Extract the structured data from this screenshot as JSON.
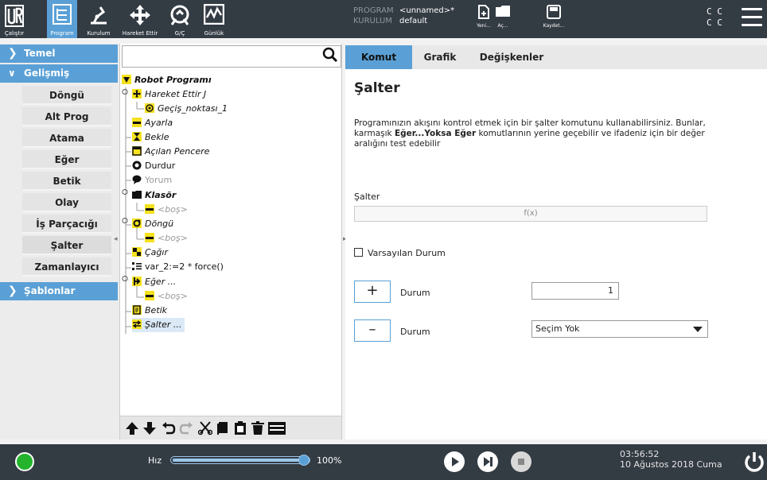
{
  "topbar": {
    "nav": [
      {
        "id": "run",
        "label": "Çalıştır",
        "icon": "ur-logo-icon"
      },
      {
        "id": "program",
        "label": "Program",
        "icon": "program-icon",
        "active": true
      },
      {
        "id": "installation",
        "label": "Kurulum",
        "icon": "installation-icon"
      },
      {
        "id": "move",
        "label": "Hareket Ettir",
        "icon": "move-icon"
      },
      {
        "id": "io",
        "label": "G/Ç",
        "icon": "io-icon"
      },
      {
        "id": "log",
        "label": "Günlük",
        "icon": "log-icon"
      }
    ],
    "program_key": "PROGRAM",
    "program_value": "<unnamed>*",
    "installation_key": "KURULUM",
    "installation_value": "default",
    "file_buttons": [
      {
        "id": "new",
        "label": "Yeni..."
      },
      {
        "id": "open",
        "label": "Aç..."
      },
      {
        "id": "save",
        "label": "Kaydet..."
      }
    ],
    "cc_line1": "C C",
    "cc_line2": "C C"
  },
  "leftmenu": {
    "basic": "Temel",
    "advanced": "Gelişmiş",
    "templates": "Şablonlar",
    "items": [
      "Döngü",
      "Alt Prog",
      "Atama",
      "Eğer",
      "Betik",
      "Olay",
      "İş Parçacığı",
      "Şalter",
      "Zamanlayıcı"
    ]
  },
  "tree": {
    "search_placeholder": "",
    "root": "Robot Programı",
    "nodes": [
      "Hareket Ettir J",
      "Geçiş_noktası_1",
      "Ayarla",
      "Bekle",
      "Açılan Pencere",
      "Durdur",
      "Yorum",
      "Klasör",
      "<boş>",
      "Döngü",
      "<boş>",
      "Çağır",
      "var_2:=2 * force()",
      "Eğer ...",
      "<boş>",
      "Betik",
      "Şalter ..."
    ]
  },
  "tabs": [
    "Komut",
    "Grafik",
    "Değişkenler"
  ],
  "content": {
    "title": "Şalter",
    "desc_part1": "Programınızın akışını kontrol etmek için bir şalter komutunu kullanabilirsiniz. Bunlar, karmaşık ",
    "desc_bold": "Eğer...Yoksa Eğer",
    "desc_part2": " komutlarının yerine geçebilir ve ifadeniz için bir değer aralığını test edebilir",
    "switch_label": "Şalter",
    "expression": "f(x)",
    "default_case": "Varsayılan Durum",
    "add_symbol": "+",
    "remove_symbol": "–",
    "case_label_1": "Durum",
    "case_label_2": "Durum",
    "case_value": "1",
    "case_select": "Seçim Yok"
  },
  "bottombar": {
    "speed_label": "Hız",
    "speed_value": "100%",
    "speed_fraction": 1.0,
    "time": "03:56:52",
    "date": "10 Ağustos 2018 Cuma",
    "status_color": "#23b32c"
  }
}
